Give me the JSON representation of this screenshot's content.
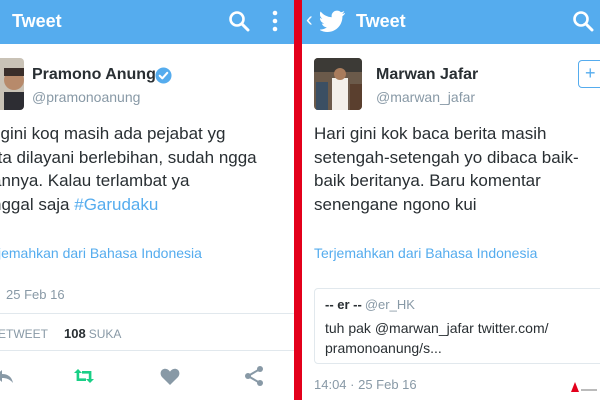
{
  "left": {
    "appbar": {
      "title": "Tweet"
    },
    "author": {
      "name": "Pramono Anung",
      "handle": "@pramonoanung"
    },
    "tweet": {
      "lines": [
        "i gini koq masih ada pejabat yg",
        "rta dilayani berlebihan, sudah ngga",
        "annya. Kalau terlambat ya",
        "nggal saja "
      ],
      "hashtag": "#Garudaku"
    },
    "translate": "jemahkan dari Bahasa Indonesia",
    "timestamp": "25 Feb 16",
    "stats": {
      "retweets_label": "ETWEET",
      "likes_count": "108",
      "likes_label": "SUKA"
    }
  },
  "right": {
    "appbar": {
      "title": "Tweet",
      "back": "‹"
    },
    "author": {
      "name": "Marwan Jafar",
      "handle": "@marwan_jafar"
    },
    "tweet": {
      "lines": [
        "Hari gini kok baca berita masih",
        "setengah-setengah yo dibaca baik-",
        "baik beritanya. Baru komentar",
        "senengane ngono kui"
      ]
    },
    "translate": "Terjemahkan dari Bahasa Indonesia",
    "quote": {
      "name": "-- er --",
      "handle": "@er_HK",
      "lines": [
        "tuh pak @marwan_jafar  twitter.com/",
        "pramonoanung/s..."
      ]
    },
    "timestamp": "14:04 · 25 Feb 16"
  },
  "colors": {
    "twitter_blue": "#55acee",
    "divider_red": "#e3001b",
    "text_dark": "#292f33",
    "text_gray": "#8899a6",
    "retweet_green": "#19cf86"
  },
  "icons": [
    "search-icon",
    "more-vertical-icon",
    "twitter-bird-icon",
    "back-chevron-icon",
    "verified-icon",
    "follow-icon",
    "reply-icon",
    "retweet-icon",
    "like-icon",
    "share-icon"
  ]
}
